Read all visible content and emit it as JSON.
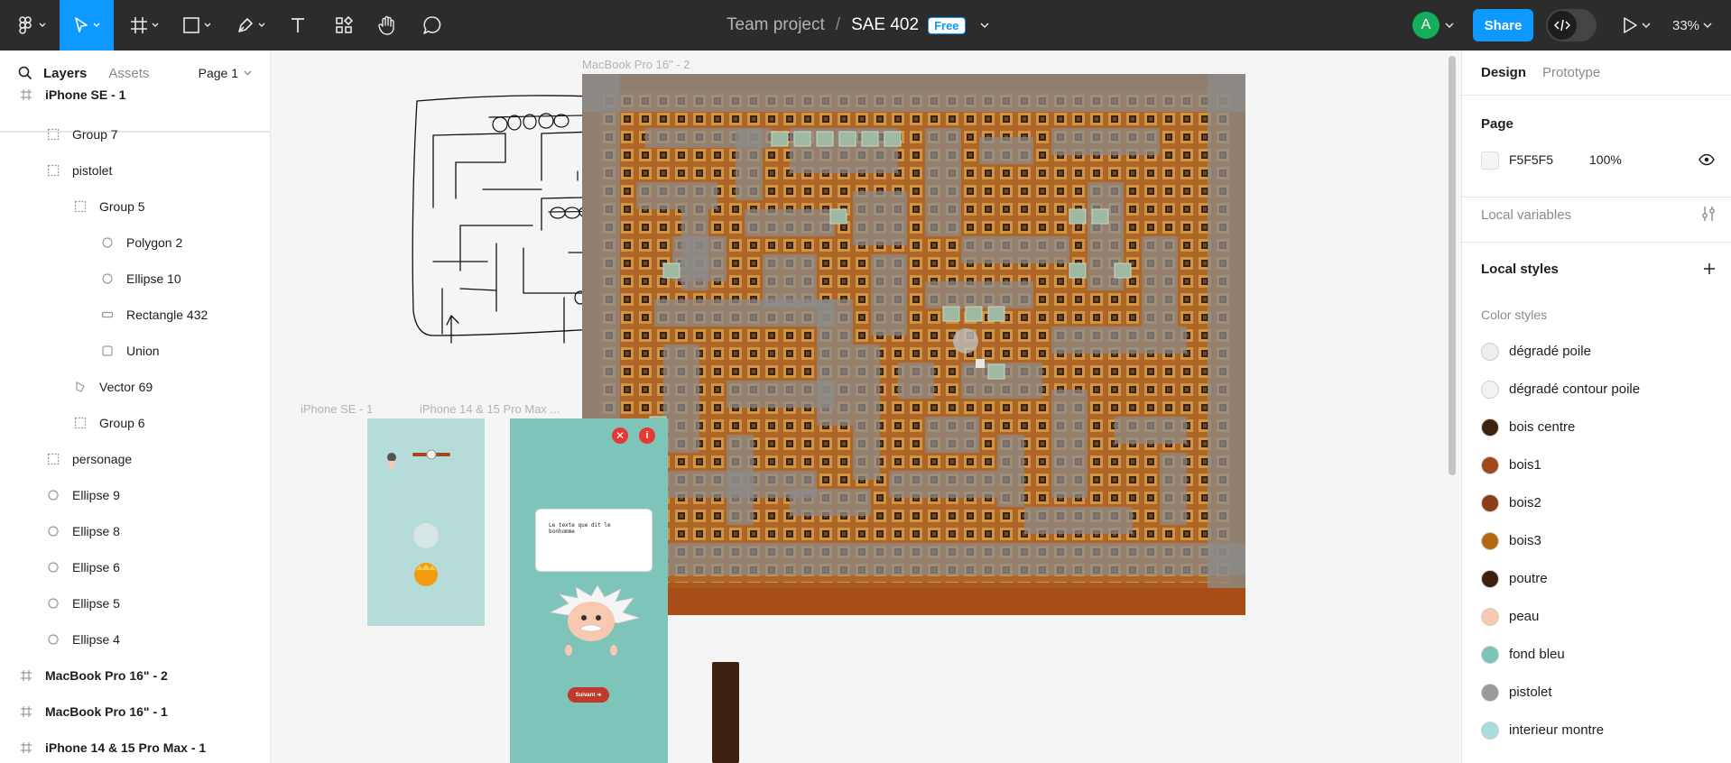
{
  "toolbar": {
    "team": "Team project",
    "separator": "/",
    "file": "SAE 402",
    "badge": "Free",
    "avatar_letter": "A",
    "share": "Share",
    "zoom": "33%",
    "active_tool": "move-tool"
  },
  "left": {
    "tab_layers": "Layers",
    "tab_assets": "Assets",
    "page": "Page 1",
    "layers": [
      {
        "name": "iPhone SE - 1",
        "icon": "frame-icon",
        "bold": true
      },
      {
        "name": "Group 7",
        "icon": "group-icon"
      },
      {
        "name": "pistolet",
        "icon": "group-icon"
      },
      {
        "name": "Group 5",
        "icon": "group-icon"
      },
      {
        "name": "Polygon 2",
        "icon": "polygon-icon"
      },
      {
        "name": "Ellipse 10",
        "icon": "ellipse-icon"
      },
      {
        "name": "Rectangle 432",
        "icon": "rectangle-icon"
      },
      {
        "name": "Union",
        "icon": "union-icon"
      },
      {
        "name": "Vector 69",
        "icon": "vector-icon"
      },
      {
        "name": "Group 6",
        "icon": "group-icon"
      },
      {
        "name": "personage",
        "icon": "group-icon"
      },
      {
        "name": "Ellipse 9",
        "icon": "ellipse-icon"
      },
      {
        "name": "Ellipse 8",
        "icon": "ellipse-icon"
      },
      {
        "name": "Ellipse 6",
        "icon": "ellipse-icon"
      },
      {
        "name": "Ellipse 5",
        "icon": "ellipse-icon"
      },
      {
        "name": "Ellipse 4",
        "icon": "ellipse-icon"
      },
      {
        "name": "MacBook Pro 16\" - 2",
        "icon": "frame-icon",
        "bold": true
      },
      {
        "name": "MacBook Pro 16\" - 1",
        "icon": "frame-icon",
        "bold": true
      },
      {
        "name": "iPhone 14 & 15 Pro Max - 1",
        "icon": "frame-icon",
        "bold": true
      }
    ]
  },
  "canvas": {
    "frame_macbook": "MacBook Pro 16\" - 2",
    "frame_iphone_se": "iPhone SE - 1",
    "frame_iphone_14": "iPhone 14 & 15 Pro Max ...",
    "speech_text": "Le texte que dit le bonhomme",
    "next_button": "Suivant"
  },
  "right": {
    "tab_design": "Design",
    "tab_prototype": "Prototype",
    "page_heading": "Page",
    "page_color": "F5F5F5",
    "page_opacity": "100%",
    "local_variables": "Local variables",
    "local_styles": "Local styles",
    "color_styles": "Color styles",
    "styles": [
      {
        "name": "dégradé poile",
        "color": "#eeeeee"
      },
      {
        "name": "dégradé contour poile",
        "color": "#f2f2f2"
      },
      {
        "name": "bois centre",
        "color": "#3a2410"
      },
      {
        "name": "bois1",
        "color": "#a0491f"
      },
      {
        "name": "bois2",
        "color": "#8c3e1a"
      },
      {
        "name": "bois3",
        "color": "#b36a12"
      },
      {
        "name": "poutre",
        "color": "#3d2010"
      },
      {
        "name": "peau",
        "color": "#f8c9b0"
      },
      {
        "name": "fond bleu",
        "color": "#7cc4b8"
      },
      {
        "name": "pistolet",
        "color": "#9a9a9a"
      },
      {
        "name": "interieur montre",
        "color": "#a8dde0"
      }
    ]
  }
}
